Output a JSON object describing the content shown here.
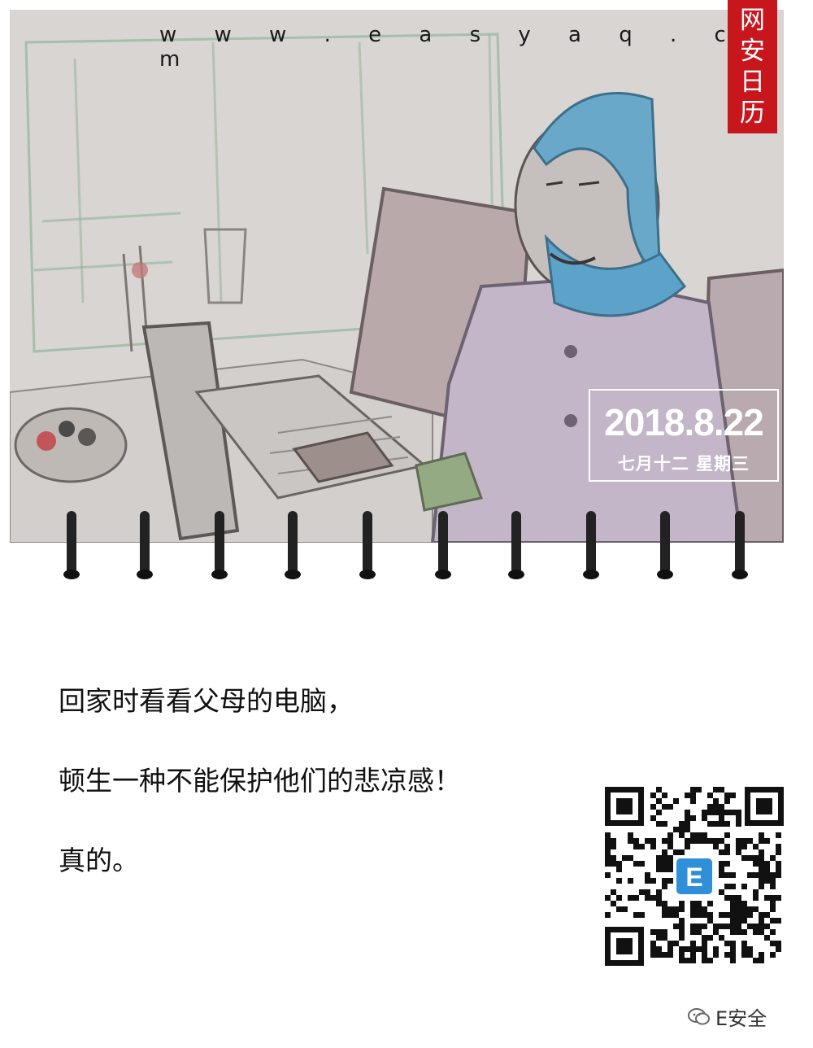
{
  "header": {
    "url": "w w w . e a s y a q . c o m",
    "tag_chars": [
      "网",
      "安",
      "日",
      "历"
    ]
  },
  "calendar": {
    "date": "2018.8.22",
    "lunar_weekday": "七月十二  星期三"
  },
  "message": {
    "line1": "回家时看看父母的电脑，",
    "line2": "顿生一种不能保护他们的悲凉感！",
    "line3": "真的。"
  },
  "qr": {
    "center_letter": "E"
  },
  "watermark": {
    "text": "E安全",
    "icon": "wechat-icon"
  },
  "colors": {
    "tag_red": "#c8161d",
    "paper_gray": "#d9d6d4",
    "qr_blue": "#2f8fd8"
  }
}
